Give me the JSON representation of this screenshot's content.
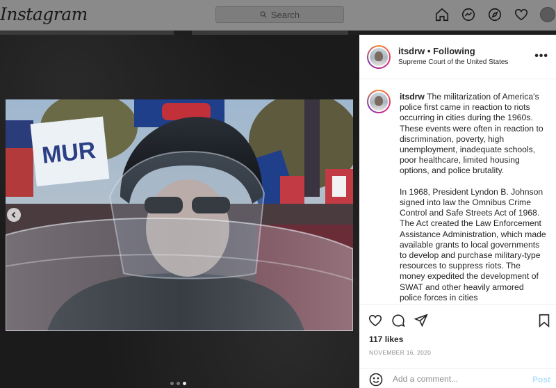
{
  "nav": {
    "logo": "Instagram",
    "search_placeholder": "Search",
    "icons": [
      "home-icon",
      "messenger-icon",
      "explore-icon",
      "heart-icon",
      "profile-avatar"
    ]
  },
  "post": {
    "username": "itsdrw",
    "follow_status": "• Following",
    "location": "Supreme Court of the United States",
    "more": "•••",
    "caption": "The militarization of America's police first came in reaction to riots occurring in cities during the 1960s. These events were often in reaction to discrimination, poverty, high unemployment, inadequate schools, poor healthcare, limited housing options, and police brutality.\n\nIn 1968, President Lyndon B. Johnson signed into law the Omnibus Crime Control and Safe Streets Act of 1968. The Act created the Law Enforcement Assistance Administration, which made available grants to local governments to develop and purchase military-type resources to suppress riots. The money expedited the development of SWAT and other heavily armored police forces in cities",
    "likes": "117 likes",
    "date": "NOVEMBER 16, 2020",
    "carousel_total": 3,
    "carousel_active_index": 2
  },
  "comment": {
    "placeholder": "Add a comment...",
    "post_label": "Post"
  },
  "colors": {
    "accent_disabled": "#b2dffc",
    "muted": "#8e8e8e",
    "text": "#262626"
  }
}
